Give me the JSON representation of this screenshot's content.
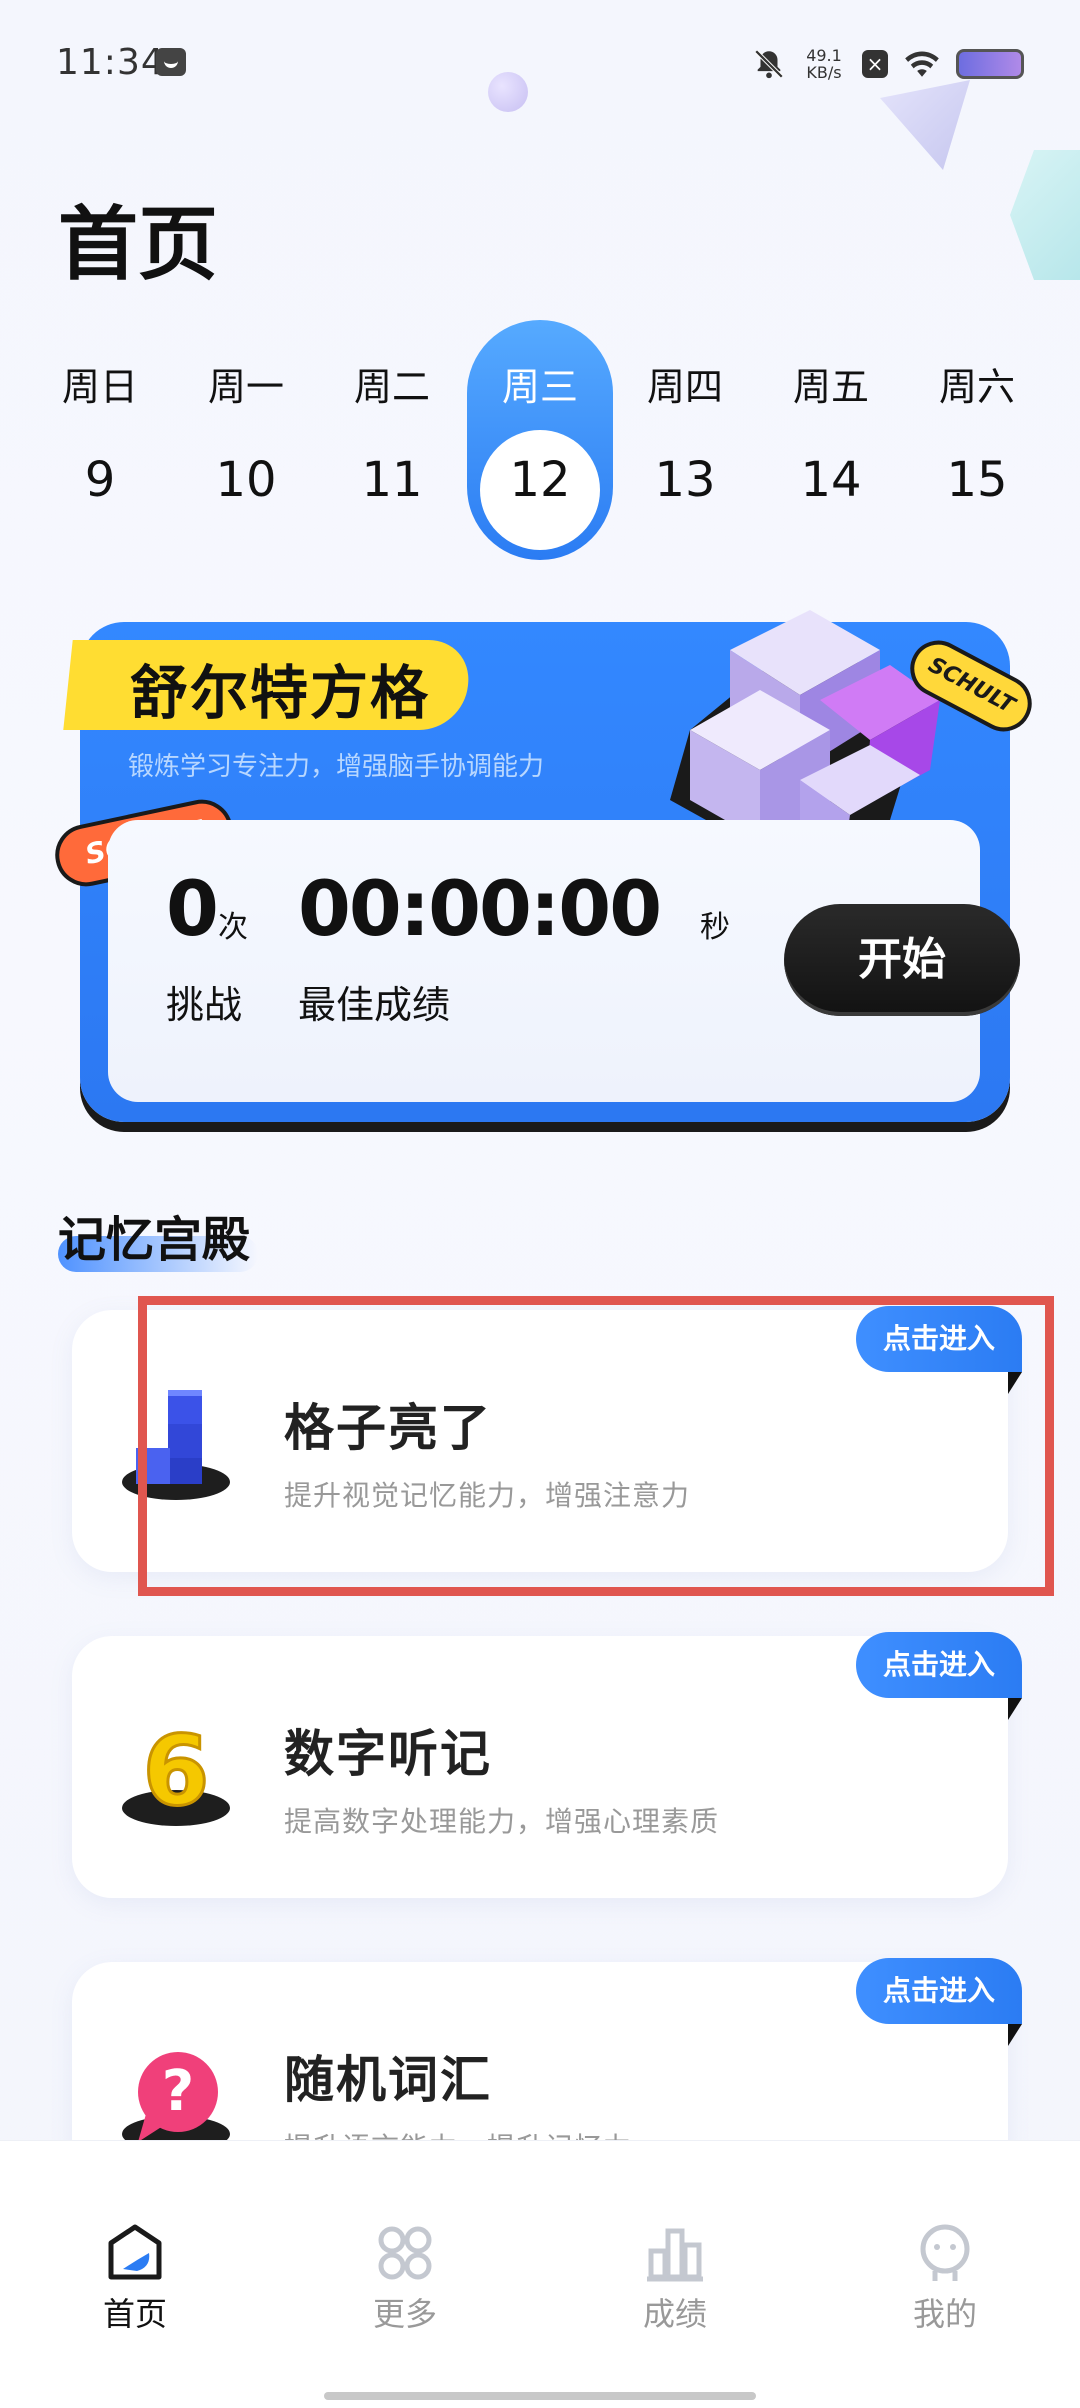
{
  "status_bar": {
    "time": "11:34",
    "net_speed_value": "49.1",
    "net_speed_unit": "KB/s",
    "icons": [
      "message-icon",
      "bell-off-icon",
      "x-box-icon",
      "wifi-icon",
      "battery-icon"
    ]
  },
  "page": {
    "title": "首页"
  },
  "week": {
    "days": [
      {
        "name": "周日",
        "num": "9"
      },
      {
        "name": "周一",
        "num": "10"
      },
      {
        "name": "周二",
        "num": "11"
      },
      {
        "name": "周三",
        "num": "12",
        "active": true
      },
      {
        "name": "周四",
        "num": "13"
      },
      {
        "name": "周五",
        "num": "14"
      },
      {
        "name": "周六",
        "num": "15"
      }
    ]
  },
  "schulte": {
    "title": "舒尔特方格",
    "subtitle": "锻炼学习专注力，增强脑手协调能力",
    "sticker_left": "SCHULT",
    "sticker_right": "SCHULT",
    "challenge_count": "0",
    "challenge_unit": "次",
    "challenge_label": "挑战",
    "best_time": "00:00:00",
    "best_time_unit": "秒",
    "best_label": "最佳成绩",
    "start_label": "开始"
  },
  "section": {
    "title": "记忆宫殿"
  },
  "games": [
    {
      "name": "格子亮了",
      "desc": "提升视觉记忆能力，增强注意力",
      "enter": "点击进入",
      "icon": "blocks-icon"
    },
    {
      "name": "数字听记",
      "desc": "提高数字处理能力，增强心理素质",
      "enter": "点击进入",
      "icon": "number-six-icon"
    },
    {
      "name": "随机词汇",
      "desc": "提升语言能力，提升记忆力",
      "enter": "点击进入",
      "icon": "question-bubble-icon"
    }
  ],
  "nav": {
    "items": [
      {
        "label": "首页",
        "icon": "home-icon",
        "active": true
      },
      {
        "label": "更多",
        "icon": "grid-icon"
      },
      {
        "label": "成绩",
        "icon": "bar-chart-icon"
      },
      {
        "label": "我的",
        "icon": "profile-icon"
      }
    ]
  },
  "colors": {
    "accent_blue": "#2b7cf3",
    "yellow_tag": "#ffdd32",
    "highlight_red": "#e0564f"
  }
}
